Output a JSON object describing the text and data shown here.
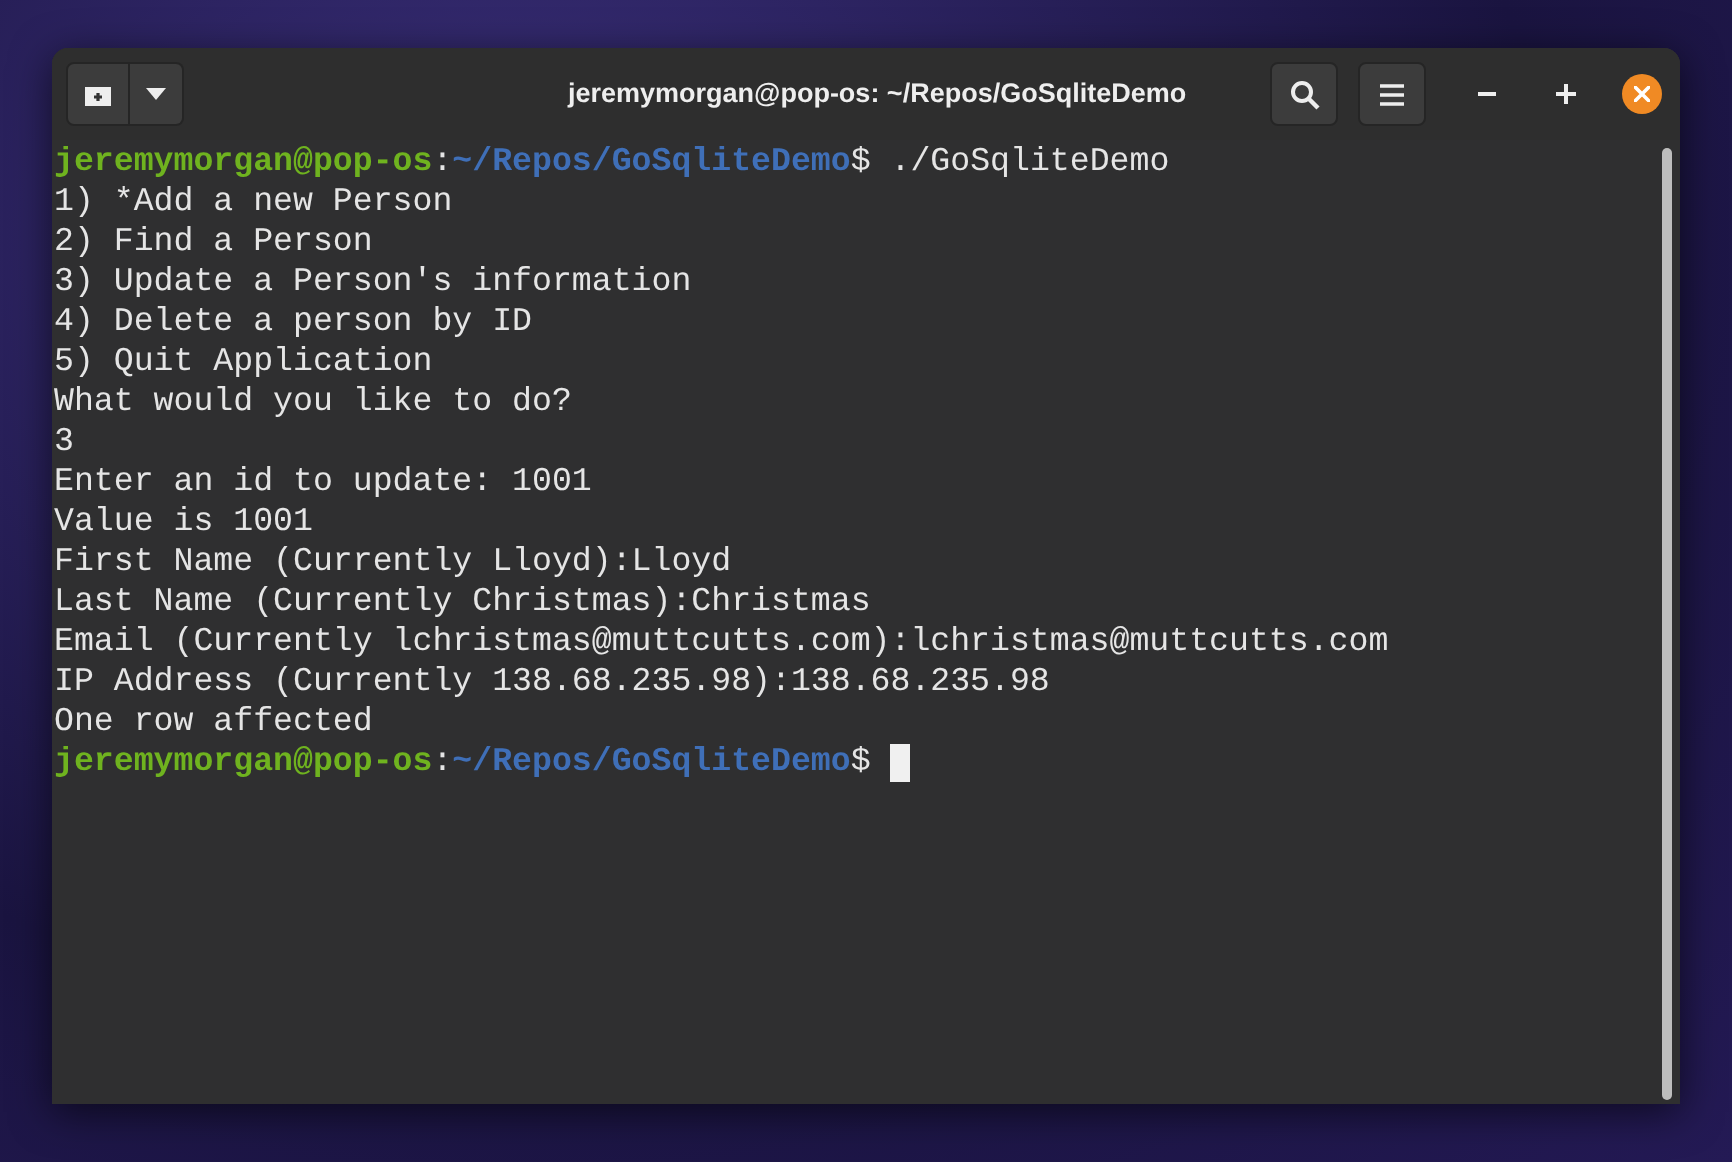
{
  "window": {
    "title": "jeremymorgan@pop-os: ~/Repos/GoSqliteDemo"
  },
  "terminal": {
    "lines": [
      {
        "kind": "prompt",
        "user_host": "jeremymorgan@pop-os",
        "separator": ":",
        "path": "~/Repos/GoSqliteDemo",
        "command": "$ ./GoSqliteDemo"
      },
      {
        "kind": "output",
        "text": "1) *Add a new Person"
      },
      {
        "kind": "output",
        "text": "2) Find a Person"
      },
      {
        "kind": "output",
        "text": "3) Update a Person's information"
      },
      {
        "kind": "output",
        "text": "4) Delete a person by ID"
      },
      {
        "kind": "output",
        "text": "5) Quit Application"
      },
      {
        "kind": "output",
        "text": "What would you like to do?"
      },
      {
        "kind": "output",
        "text": "3"
      },
      {
        "kind": "output",
        "text": "Enter an id to update: 1001"
      },
      {
        "kind": "output",
        "text": "Value is 1001"
      },
      {
        "kind": "output",
        "text": "First Name (Currently Lloyd):Lloyd"
      },
      {
        "kind": "output",
        "text": "Last Name (Currently Christmas):Christmas"
      },
      {
        "kind": "output",
        "text": "Email (Currently lchristmas@muttcutts.com):lchristmas@muttcutts.com"
      },
      {
        "kind": "output",
        "text": "IP Address (Currently 138.68.235.98):138.68.235.98"
      },
      {
        "kind": "output",
        "text": "One row affected"
      },
      {
        "kind": "prompt",
        "user_host": "jeremymorgan@pop-os",
        "separator": ":",
        "path": "~/Repos/GoSqliteDemo",
        "command": "$",
        "cursor": true
      }
    ]
  }
}
